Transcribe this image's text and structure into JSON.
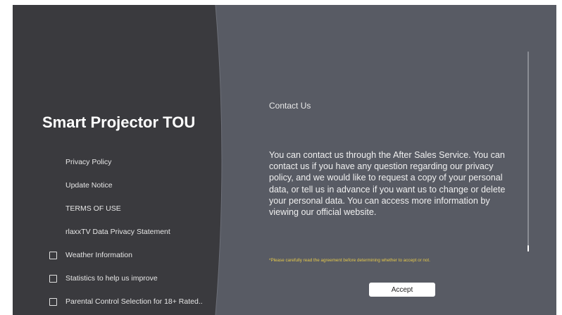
{
  "app": {
    "title": "Smart Projector TOU"
  },
  "sidebar": {
    "items": [
      {
        "label": "Privacy Policy"
      },
      {
        "label": "Update Notice"
      },
      {
        "label": "TERMS OF USE"
      },
      {
        "label": "rlaxxTV Data Privacy Statement"
      }
    ],
    "options": [
      {
        "label": "Weather Information",
        "checked": false
      },
      {
        "label": "Statistics to help us improve",
        "checked": false
      },
      {
        "label": "Parental Control Selection for 18+ Rated..",
        "checked": false
      }
    ]
  },
  "content": {
    "heading": "Contact Us",
    "body": "You can contact us through the After Sales Service. You can contact us if you have any question regarding our privacy policy, and we would like to request a copy of your personal data, or tell us in advance if you want us to change or delete your personal data. You can access more information by viewing our official website.",
    "notice": "*Please carefully read the agreement before determining whether to accept or not.",
    "accept_label": "Accept",
    "scroll_position": 0.97
  },
  "colors": {
    "left_panel": "#3a3a3e",
    "right_panel": "#585b64",
    "notice": "#e5c84a",
    "button_bg": "#ffffff"
  }
}
